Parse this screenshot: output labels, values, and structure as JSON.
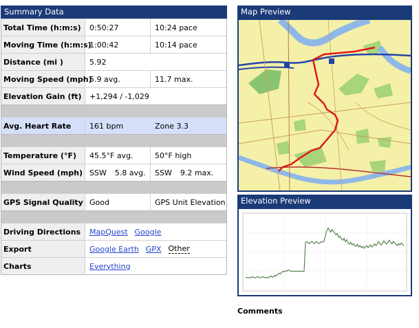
{
  "summary": {
    "title": "Summary Data",
    "rows": [
      {
        "label": "Total Time (h:m:s)",
        "v1": "0:50:27",
        "v2": "10:24 pace"
      },
      {
        "label": "Moving Time (h:m:s)",
        "v1": "1:00:42",
        "v2": "10:14 pace"
      },
      {
        "label": "Distance (mi )",
        "v1": "5.92",
        "v2": ""
      },
      {
        "label": "Moving Speed (mph)",
        "v1": "5.9 avg.",
        "v2": "11.7 max."
      },
      {
        "label": "Elevation Gain (ft)",
        "v1": "+1,294 / -1,029",
        "v2": ""
      },
      {
        "label": "Avg. Heart Rate",
        "v1": "161 bpm",
        "v2": "Zone 3.3"
      },
      {
        "label": "Temperature (°F)",
        "v1": "45.5°F avg.",
        "v2": "50°F high"
      },
      {
        "label": "Wind Speed (mph)",
        "v1a": "SSW",
        "v1b": "5.8 avg.",
        "v2a": "SSW",
        "v2b": "9.2 max."
      },
      {
        "label": "GPS Signal Quality",
        "v1": "Good",
        "v2": "GPS Unit Elevation"
      },
      {
        "label": "Driving Directions",
        "links": [
          "MapQuest",
          "Google"
        ]
      },
      {
        "label": "Export",
        "links": [
          "Google Earth",
          "GPX"
        ],
        "extra": "Other"
      },
      {
        "label": "Charts",
        "links": [
          "Everything"
        ]
      }
    ]
  },
  "map": {
    "title": "Map Preview",
    "colors": {
      "land": "#f5f0a8",
      "park": "#a8d47a",
      "water": "#8fb8e8",
      "route": "#e01818",
      "highway": "#2244aa"
    }
  },
  "elevation": {
    "title": "Elevation Preview",
    "line_color": "#4a7a40",
    "profile": [
      12,
      13,
      12,
      13,
      12,
      14,
      13,
      12,
      13,
      14,
      13,
      12,
      13,
      14,
      13,
      12,
      13,
      12,
      14,
      15,
      13,
      14,
      16,
      15,
      17,
      19,
      18,
      20,
      22,
      21,
      23,
      22,
      24,
      23,
      22,
      22,
      22,
      22,
      22,
      22,
      22,
      22,
      22,
      22,
      22,
      65,
      66,
      64,
      63,
      65,
      66,
      64,
      63,
      66,
      65,
      63,
      64,
      66,
      65,
      67,
      75,
      82,
      86,
      83,
      80,
      84,
      81,
      79,
      76,
      78,
      72,
      74,
      70,
      68,
      71,
      66,
      69,
      64,
      62,
      65,
      61,
      63,
      60,
      59,
      62,
      58,
      60,
      57,
      59,
      56,
      58,
      60,
      57,
      59,
      61,
      58,
      60,
      63,
      60,
      62,
      66,
      63,
      61,
      64,
      67,
      64,
      62,
      65,
      68,
      65,
      63,
      66,
      64,
      62,
      60,
      63,
      61,
      64,
      62,
      60
    ]
  },
  "comments": {
    "title": "Comments"
  }
}
